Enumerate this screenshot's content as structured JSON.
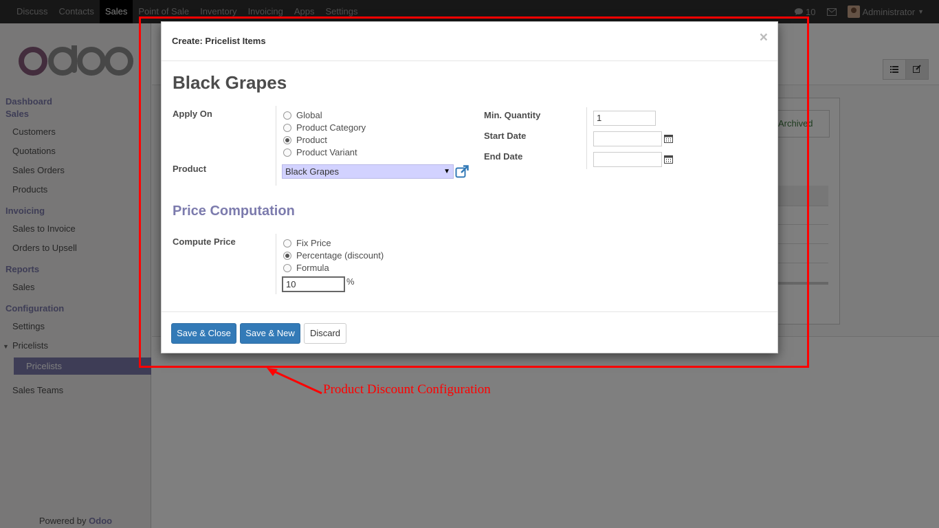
{
  "topbar": {
    "menu": [
      "Discuss",
      "Contacts",
      "Sales",
      "Point of Sale",
      "Inventory",
      "Invoicing",
      "Apps",
      "Settings"
    ],
    "active": "Sales",
    "messages_count": "10",
    "user": "Administrator"
  },
  "sidebar": {
    "logo_text": "odoo",
    "dashboard": "Dashboard",
    "sales_head": "Sales",
    "customers": "Customers",
    "quotations": "Quotations",
    "sales_orders": "Sales Orders",
    "products": "Products",
    "invoicing_head": "Invoicing",
    "sales_to_invoice": "Sales to Invoice",
    "orders_to_upsell": "Orders to Upsell",
    "reports_head": "Reports",
    "reports_sales": "Sales",
    "configuration_head": "Configuration",
    "settings": "Settings",
    "pricelists_group": "Pricelists",
    "pricelists_item": "Pricelists",
    "sales_teams": "Sales Teams",
    "powered_prefix": "Powered by",
    "powered_brand": "Odoo"
  },
  "background": {
    "archived_button": "t Archived"
  },
  "modal": {
    "title": "Create: Pricelist Items",
    "close": "×",
    "record_name": "Black Grapes",
    "apply_on_label": "Apply On",
    "apply_on_options": [
      "Global",
      "Product Category",
      "Product",
      "Product Variant"
    ],
    "apply_on_selected": "Product",
    "product_label": "Product",
    "product_value": "Black Grapes",
    "min_qty_label": "Min. Quantity",
    "min_qty_value": "1",
    "start_date_label": "Start Date",
    "start_date_value": "",
    "end_date_label": "End Date",
    "end_date_value": "",
    "section_title": "Price Computation",
    "compute_price_label": "Compute Price",
    "compute_options": [
      "Fix Price",
      "Percentage (discount)",
      "Formula"
    ],
    "compute_selected": "Percentage (discount)",
    "percentage_value": "10",
    "percent_sign": "%",
    "buttons": {
      "save_close": "Save & Close",
      "save_new": "Save & New",
      "discard": "Discard"
    }
  },
  "annotation": {
    "text": "Product Discount Configuration",
    "color": "#ff0000"
  },
  "colors": {
    "brand": "#7c7bad",
    "primary_button": "#337ab7",
    "topbar": "#2f2f2f"
  }
}
